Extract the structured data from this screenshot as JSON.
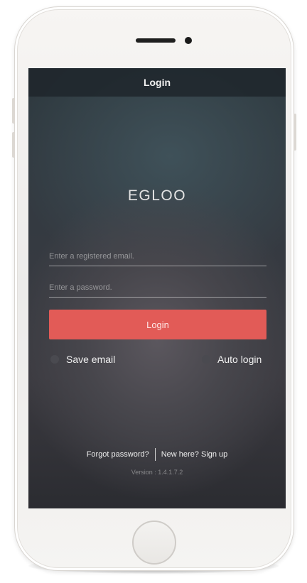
{
  "navbar": {
    "title": "Login"
  },
  "app": {
    "logo_text": "EGLOO"
  },
  "form": {
    "email_placeholder": "Enter a registered email.",
    "email_value": "",
    "password_placeholder": "Enter a password.",
    "password_value": "",
    "login_label": "Login"
  },
  "options": {
    "save_email_label": "Save email",
    "save_email_checked": false,
    "auto_login_label": "Auto login",
    "auto_login_checked": false
  },
  "footer": {
    "forgot_label": "Forgot password?",
    "signup_label": "New here? Sign up",
    "version_text": "Version : 1.4.1.7.2"
  },
  "colors": {
    "accent": "#e25b57",
    "screen_background": "#343a41"
  },
  "icons": {
    "device_frame": "phone-frame",
    "home_button": "home-button-icon",
    "camera": "camera-icon",
    "speaker": "speaker-icon"
  }
}
